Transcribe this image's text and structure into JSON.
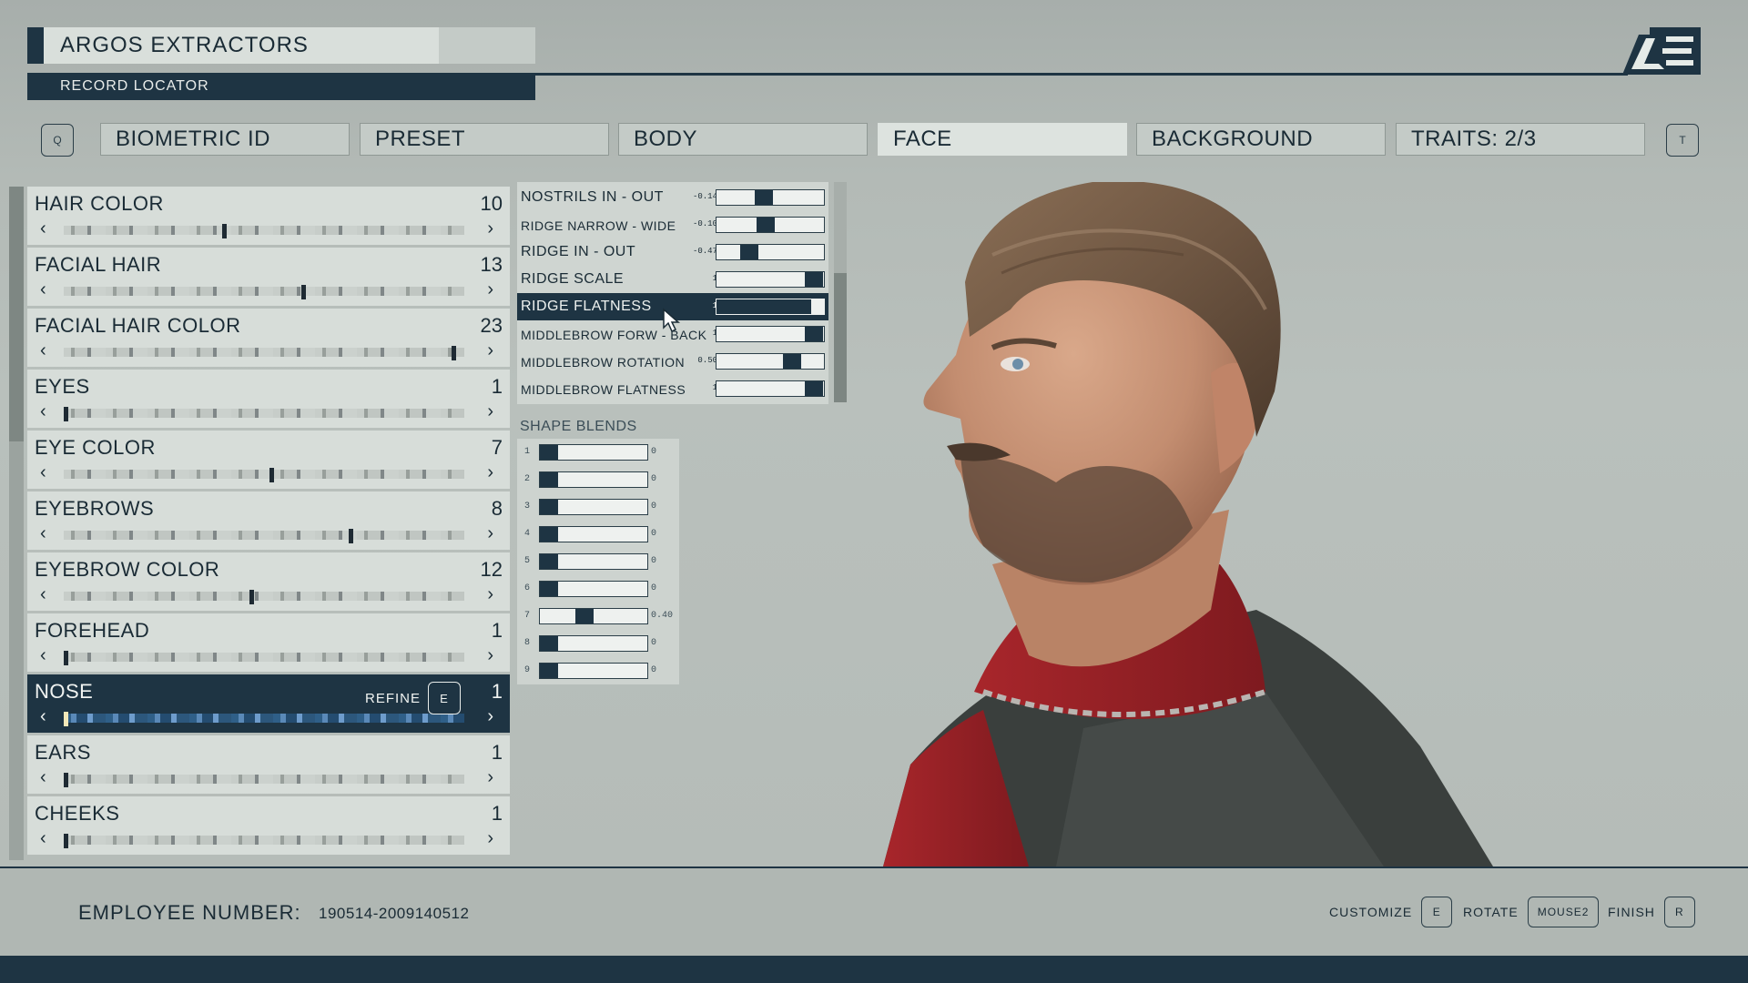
{
  "header": {
    "company_name": "ARGOS EXTRACTORS",
    "record_label": "RECORD LOCATOR",
    "left_key": "Q",
    "right_key": "T"
  },
  "tabs": [
    {
      "label": "BIOMETRIC ID",
      "active": false
    },
    {
      "label": "PRESET",
      "active": false
    },
    {
      "label": "BODY",
      "active": false
    },
    {
      "label": "FACE",
      "active": true
    },
    {
      "label": "BACKGROUND",
      "active": false
    },
    {
      "label": "TRAITS: 2/3",
      "active": false
    }
  ],
  "attributes": [
    {
      "name": "HAIR COLOR",
      "value": "10",
      "marker": 0.4
    },
    {
      "name": "FACIAL HAIR",
      "value": "13",
      "marker": 0.6
    },
    {
      "name": "FACIAL HAIR COLOR",
      "value": "23",
      "marker": 0.98
    },
    {
      "name": "EYES",
      "value": "1",
      "marker": 0.0
    },
    {
      "name": "EYE COLOR",
      "value": "7",
      "marker": 0.52
    },
    {
      "name": "EYEBROWS",
      "value": "8",
      "marker": 0.72
    },
    {
      "name": "EYEBROW COLOR",
      "value": "12",
      "marker": 0.47
    },
    {
      "name": "FOREHEAD",
      "value": "1",
      "marker": 0.0
    },
    {
      "name": "NOSE",
      "value": "1",
      "marker": 0.0,
      "active": true,
      "refine_label": "REFINE",
      "refine_key": "E"
    },
    {
      "name": "EARS",
      "value": "1",
      "marker": 0.0
    },
    {
      "name": "CHEEKS",
      "value": "1",
      "marker": 0.0
    }
  ],
  "nose_sliders": [
    {
      "label": "NOSTRILS IN - OUT",
      "value": "-0.14",
      "pos": 0.43
    },
    {
      "label": "RIDGE NARROW - WIDE",
      "value": "-0.10",
      "pos": 0.45
    },
    {
      "label": "RIDGE IN - OUT",
      "value": "-0.47",
      "pos": 0.27
    },
    {
      "label": "RIDGE SCALE",
      "value": "1",
      "pos": 1.0
    },
    {
      "label": "RIDGE FLATNESS",
      "value": "1",
      "pos": 1.0,
      "active": true
    },
    {
      "label": "MIDDLEBROW FORW - BACK",
      "value": "1",
      "pos": 1.0
    },
    {
      "label": "MIDDLEBROW ROTATION",
      "value": "0.50",
      "pos": 0.75
    },
    {
      "label": "MIDDLEBROW FLATNESS",
      "value": "1",
      "pos": 1.0
    }
  ],
  "shape_blends": {
    "title": "SHAPE BLENDS",
    "items": [
      {
        "index": "1",
        "value": "0",
        "pos": 0.0
      },
      {
        "index": "2",
        "value": "0",
        "pos": 0.0
      },
      {
        "index": "3",
        "value": "0",
        "pos": 0.0
      },
      {
        "index": "4",
        "value": "0",
        "pos": 0.0
      },
      {
        "index": "5",
        "value": "0",
        "pos": 0.0
      },
      {
        "index": "6",
        "value": "0",
        "pos": 0.0
      },
      {
        "index": "7",
        "value": "0.40",
        "pos": 0.4
      },
      {
        "index": "8",
        "value": "0",
        "pos": 0.0
      },
      {
        "index": "9",
        "value": "0",
        "pos": 0.0
      }
    ]
  },
  "footer": {
    "employee_label": "EMPLOYEE NUMBER:",
    "employee_number": "190514-2009140512",
    "hints": [
      {
        "label": "CUSTOMIZE",
        "key": "E"
      },
      {
        "label": "ROTATE",
        "key": "MOUSE2"
      },
      {
        "label": "FINISH",
        "key": "R"
      }
    ]
  },
  "colors": {
    "accent_dark": "#1e3443",
    "panel_light": "#d7ddd9",
    "background": "#b4bbb7"
  },
  "icons": {
    "logo": "ae-logo-icon",
    "cursor": "cursor-arrow-icon",
    "chevron_left": "chevron-left-icon",
    "chevron_right": "chevron-right-icon"
  }
}
